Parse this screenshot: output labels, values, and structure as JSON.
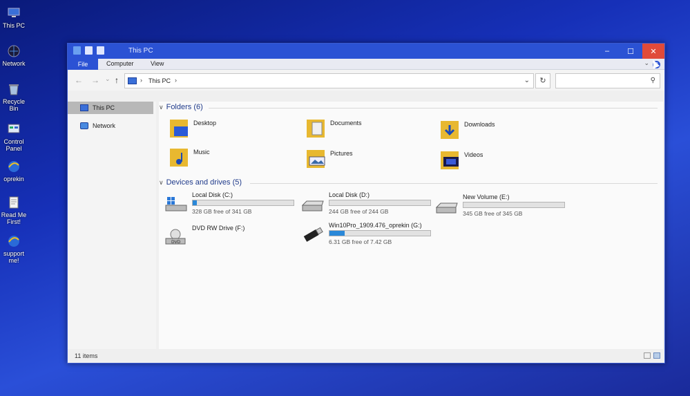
{
  "desktop": {
    "icons": [
      {
        "label": "This PC",
        "icon": "computer-icon"
      },
      {
        "label": "Network",
        "icon": "network-icon"
      },
      {
        "label": "Recycle Bin",
        "icon": "recycle-bin-icon"
      },
      {
        "label": "Control Panel",
        "icon": "control-panel-icon"
      },
      {
        "label": "oprekin",
        "icon": "internet-explorer-icon"
      },
      {
        "label": "Read Me First!",
        "icon": "document-icon"
      },
      {
        "label": "support me!",
        "icon": "internet-explorer-icon"
      }
    ]
  },
  "window": {
    "title": "This PC",
    "controls": {
      "minimize": "–",
      "maximize": "☐",
      "close": "✕"
    },
    "ribbon_tabs": [
      "File",
      "Computer",
      "View"
    ],
    "ribbon_expand": "⌄",
    "help": "?",
    "nav": {
      "back": "←",
      "forward": "→",
      "recent": "⌄",
      "up": "↑"
    },
    "address": {
      "crumb": "This PC",
      "sep": "›",
      "dropdown": "⌄"
    },
    "refresh": "↻",
    "search": {
      "placeholder": "",
      "icon": "⚲"
    },
    "sidebar": [
      {
        "label": "This PC",
        "selected": true
      },
      {
        "label": "Network",
        "selected": false
      }
    ],
    "folders_header": "Folders (6)",
    "folders": [
      {
        "name": "Desktop",
        "icon": "desktop-folder-icon"
      },
      {
        "name": "Documents",
        "icon": "documents-folder-icon"
      },
      {
        "name": "Downloads",
        "icon": "downloads-folder-icon"
      },
      {
        "name": "Music",
        "icon": "music-folder-icon"
      },
      {
        "name": "Pictures",
        "icon": "pictures-folder-icon"
      },
      {
        "name": "Videos",
        "icon": "videos-folder-icon"
      }
    ],
    "drives_header": "Devices and drives (5)",
    "drives": [
      {
        "name": "Local Disk (C:)",
        "free": "328 GB free of 341 GB",
        "used_fraction": 0.04,
        "icon": "windows-drive-icon",
        "has_bar": true
      },
      {
        "name": "Local Disk (D:)",
        "free": "244 GB free of 244 GB",
        "used_fraction": 0.0,
        "icon": "hard-drive-icon",
        "has_bar": true
      },
      {
        "name": "New Volume (E:)",
        "free": "345 GB free of 345 GB",
        "used_fraction": 0.0,
        "icon": "hard-drive-icon",
        "has_bar": true
      },
      {
        "name": "DVD RW Drive (F:)",
        "free": "",
        "used_fraction": 0.0,
        "icon": "dvd-drive-icon",
        "has_bar": false
      },
      {
        "name": "Win10Pro_1909.476_oprekin (G:)",
        "free": "6.31 GB free of 7.42 GB",
        "used_fraction": 0.15,
        "icon": "usb-drive-icon",
        "has_bar": true
      }
    ],
    "status": "11 items"
  },
  "colors": {
    "accent": "#2b52d4",
    "close": "#e04a3a",
    "bar_fill": "#2a88d8"
  }
}
